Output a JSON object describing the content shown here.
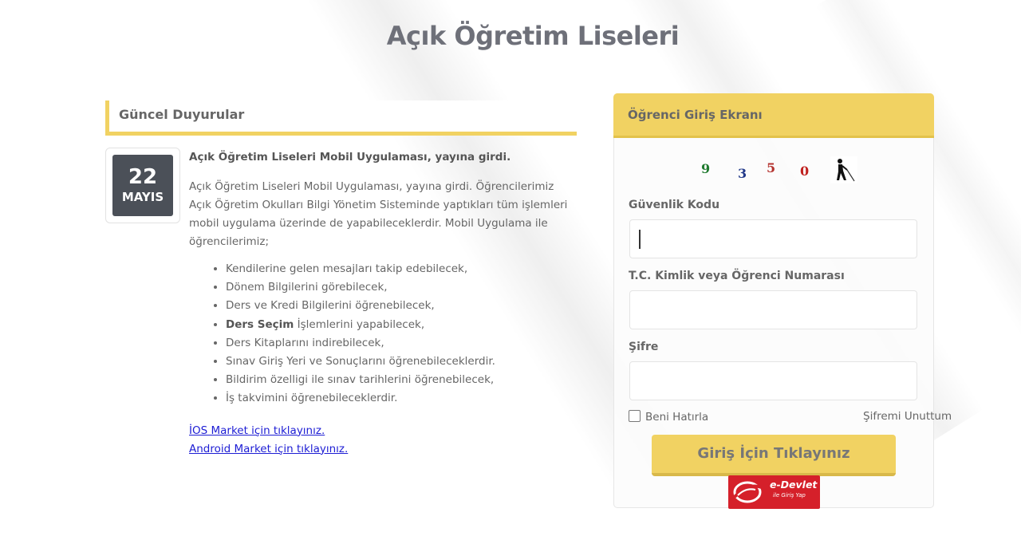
{
  "page": {
    "title": "Açık Öğretim Liseleri"
  },
  "announcements": {
    "header": "Güncel Duyurular",
    "items": [
      {
        "date_day": "22",
        "date_month": "MAYIS",
        "title": "Açık Öğretim Liseleri Mobil Uygulaması, yayına girdi.",
        "body": "Açık Öğretim Liseleri Mobil Uygulaması, yayına girdi. Öğrencilerimiz Açık Öğretim Okulları Bilgi Yönetim Sisteminde yaptıkları tüm işlemleri mobil uygulama üzerinde de yapabileceklerdir. Mobil Uygulama ile öğrencilerimiz;",
        "list": [
          "Kendilerine gelen mesajları takip edebilecek,",
          "Dönem Bilgilerini görebilecek,",
          "Ders ve Kredi Bilgilerini öğrenebilecek,",
          {
            "bold": "Ders Seçim",
            "rest": " İşlemlerini yapabilecek,"
          },
          "Ders Kitaplarını indirebilecek,",
          "Sınav Giriş Yeri ve Sonuçlarını öğrenebileceklerdir.",
          "Bildirim özelligi ile sınav tarihlerini öğrenebilecek,",
          "İş takvimini öğrenebileceklerdir."
        ],
        "links": {
          "ios": "İOS Market için tıklayınız.",
          "android": "Android Market için tıklayınız."
        }
      }
    ]
  },
  "login": {
    "header": "Öğrenci Giriş Ekranı",
    "captcha": {
      "digits": [
        "9",
        "3",
        "5",
        "0"
      ],
      "accessibility_icon": "wheelchair-accessibility-icon"
    },
    "security_code": {
      "label": "Güvenlik Kodu",
      "value": ""
    },
    "id_number": {
      "label": "T.C. Kimlik veya Öğrenci Numarası",
      "value": ""
    },
    "password": {
      "label": "Şifre",
      "value": ""
    },
    "remember_label": "Beni Hatırla",
    "remember_checked": false,
    "forgot_label": "Şifremi Unuttum",
    "submit_label": "Giriş İçin Tıklayınız",
    "edevlet": {
      "title": "e-Devlet",
      "subtitle": "ile Giriş Yap"
    }
  },
  "colors": {
    "accent": "#f1d262",
    "date_box": "#4b5058",
    "title": "#6e7079",
    "link": "#1d1dd4",
    "edevlet": "#d5202a"
  }
}
